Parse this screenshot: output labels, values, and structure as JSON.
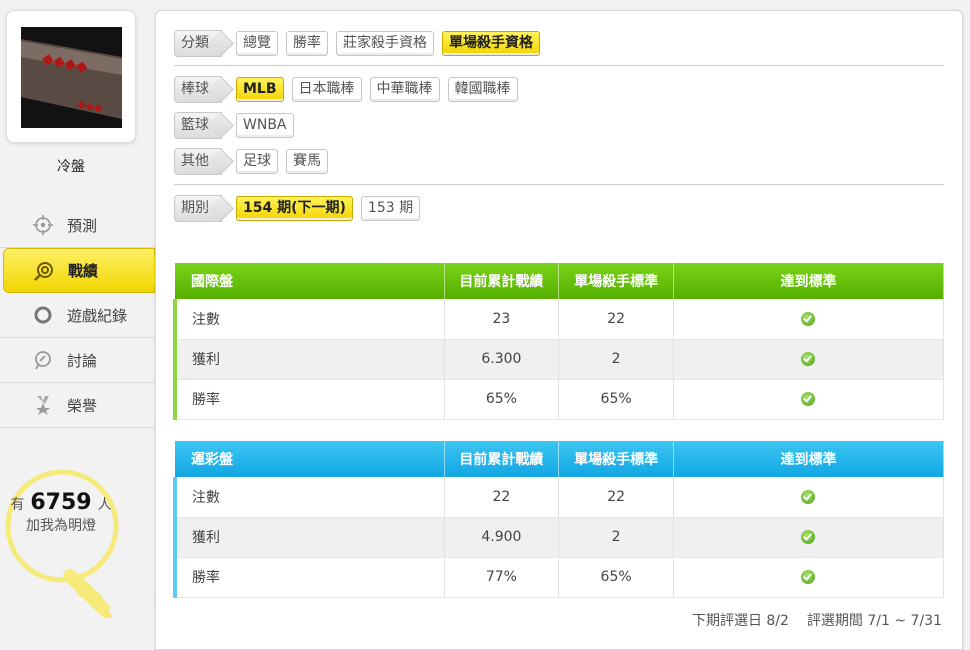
{
  "user": {
    "name": "冷盤"
  },
  "nav": [
    {
      "label": "預測",
      "icon": "target-icon",
      "active": false
    },
    {
      "label": "戰績",
      "icon": "record-icon",
      "active": true
    },
    {
      "label": "遊戲紀錄",
      "icon": "ring-icon",
      "active": false
    },
    {
      "label": "討論",
      "icon": "discussion-icon",
      "active": false
    },
    {
      "label": "榮譽",
      "icon": "medal-icon",
      "active": false
    }
  ],
  "fans": {
    "prefix": "有",
    "count": "6759",
    "suffix": "人",
    "caption": "加我為明燈"
  },
  "filters": {
    "category": {
      "label": "分類",
      "options": [
        "總覽",
        "勝率",
        "莊家殺手資格",
        "單場殺手資格"
      ],
      "selected": 3
    },
    "baseball": {
      "label": "棒球",
      "options": [
        "MLB",
        "日本職棒",
        "中華職棒",
        "韓國職棒"
      ],
      "selected": 0
    },
    "basketball": {
      "label": "籃球",
      "options": [
        "WNBA"
      ],
      "selected": -1
    },
    "other": {
      "label": "其他",
      "options": [
        "足球",
        "賽馬"
      ],
      "selected": -1
    },
    "period": {
      "label": "期別",
      "options": [
        "154 期(下一期)",
        "153 期"
      ],
      "selected": 0
    }
  },
  "table_intl": {
    "headers": [
      "國際盤",
      "目前累計戰績",
      "單場殺手標準",
      "達到標準"
    ],
    "rows": [
      {
        "name": "注數",
        "current": "23",
        "standard": "22",
        "met": true
      },
      {
        "name": "獲利",
        "current": "6.300",
        "standard": "2",
        "met": true
      },
      {
        "name": "勝率",
        "current": "65%",
        "standard": "65%",
        "met": true
      }
    ]
  },
  "table_lottery": {
    "headers": [
      "運彩盤",
      "目前累計戰績",
      "單場殺手標準",
      "達到標準"
    ],
    "rows": [
      {
        "name": "注數",
        "current": "22",
        "standard": "22",
        "met": true
      },
      {
        "name": "獲利",
        "current": "4.900",
        "standard": "2",
        "met": true
      },
      {
        "name": "勝率",
        "current": "77%",
        "standard": "65%",
        "met": true
      }
    ]
  },
  "footer": {
    "next_eval": "下期評選日 8/2",
    "eval_period": "評選期間 7/1 ~ 7/31"
  },
  "colors": {
    "accent_yellow": "#f3d400",
    "green_header": "#6cc20f",
    "blue_header": "#25b6ec"
  }
}
